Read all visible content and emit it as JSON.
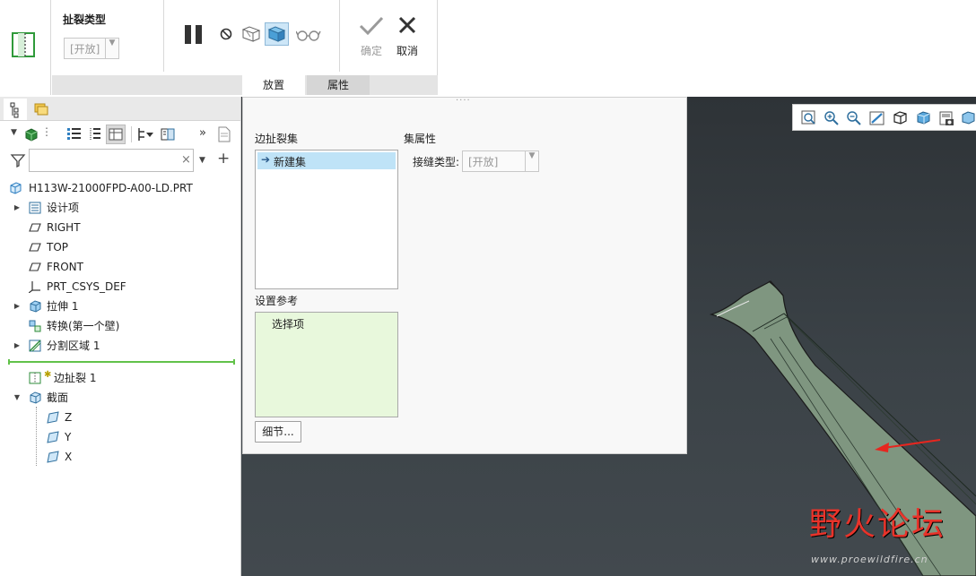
{
  "ribbon": {
    "tear_type_label": "扯裂类型",
    "tear_type_value": "[开放]",
    "confirm_label": "确定",
    "cancel_label": "取消",
    "tabs": [
      {
        "label": "放置"
      },
      {
        "label": "属性"
      }
    ]
  },
  "model_tree": {
    "search_placeholder": "",
    "items": [
      {
        "label": "H113W-21000FPD-A00-LD.PRT"
      },
      {
        "label": "设计项"
      },
      {
        "label": "RIGHT"
      },
      {
        "label": "TOP"
      },
      {
        "label": "FRONT"
      },
      {
        "label": "PRT_CSYS_DEF"
      },
      {
        "label": "拉伸 1"
      },
      {
        "label": "转换(第一个壁)"
      },
      {
        "label": "分割区域 1"
      },
      {
        "label": "边扯裂 1"
      },
      {
        "label": "截面"
      },
      {
        "label": "Z"
      },
      {
        "label": "Y"
      },
      {
        "label": "X"
      }
    ]
  },
  "dialog": {
    "edge_tear_sets_label": "边扯裂集",
    "new_set_label": "新建集",
    "set_properties_label": "集属性",
    "seam_type_label": "接缝类型:",
    "seam_type_value": "[开放]",
    "references_label": "设置参考",
    "select_item_label": "选择项",
    "details_button": "细节..."
  },
  "watermark": {
    "title": "野火论坛",
    "url": "www.proewildfire.cn"
  },
  "colors": {
    "accent_blue": "#3a8fd6",
    "model_green": "#7f9680",
    "viewport_dark": "#363c40",
    "selection_bg": "#bfe3f7",
    "reference_bg": "#e8f8dc",
    "arrow_red": "#e6261f",
    "watermark_red": "#e8332a"
  }
}
